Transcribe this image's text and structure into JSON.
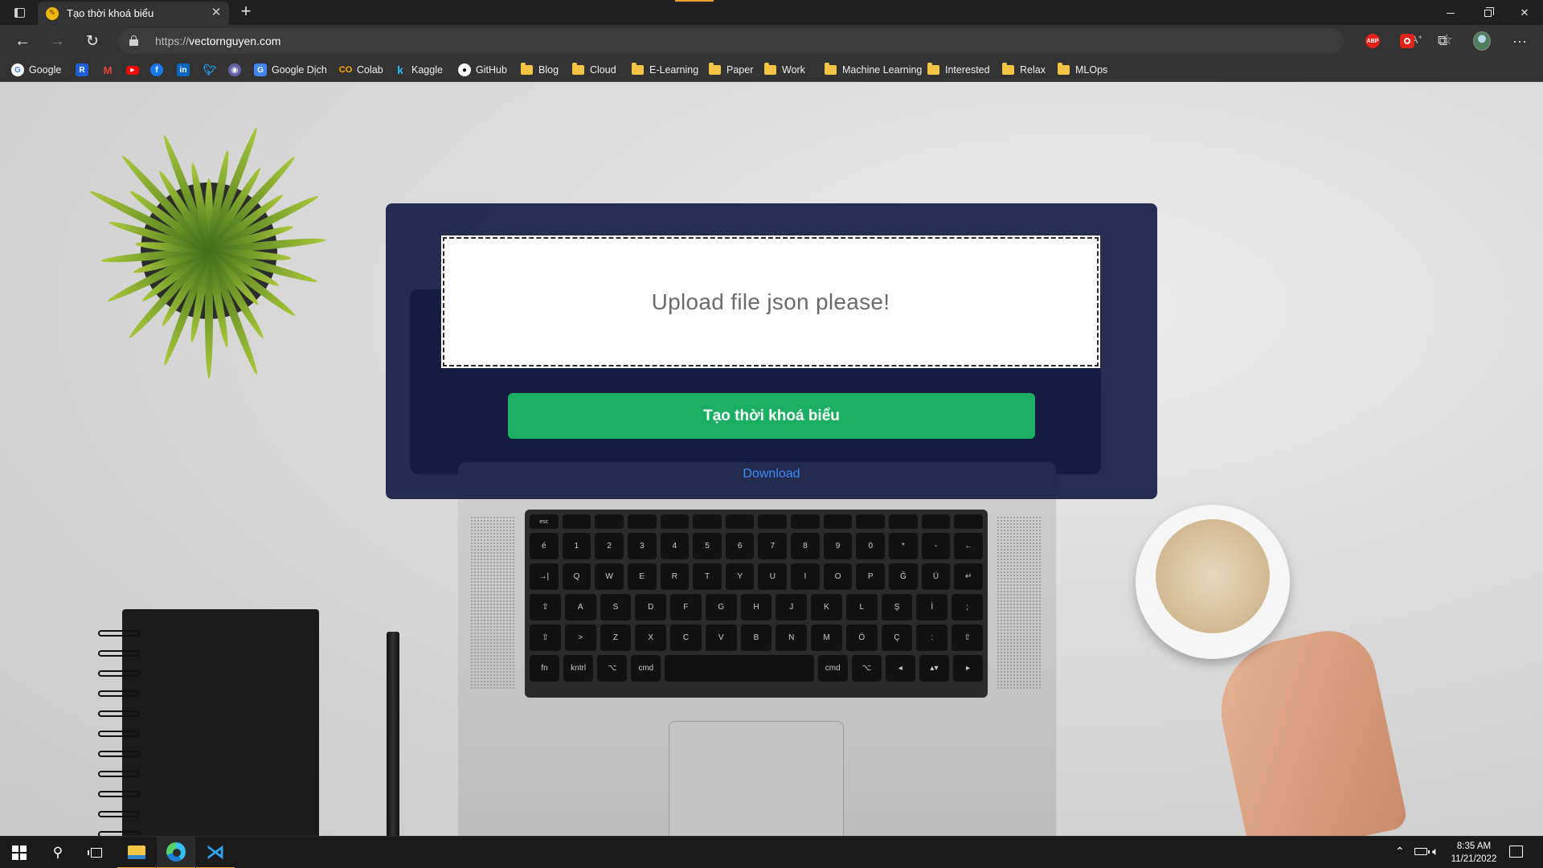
{
  "browser": {
    "tab": {
      "title": "Tạo thời khoá biểu"
    },
    "address": {
      "scheme": "https://",
      "host": "vectornguyen.com"
    },
    "bookmarks": [
      {
        "label": "Google",
        "icon": "google-icon"
      },
      {
        "label": "",
        "icon": "r-app-icon"
      },
      {
        "label": "",
        "icon": "gmail-icon"
      },
      {
        "label": "",
        "icon": "youtube-icon"
      },
      {
        "label": "",
        "icon": "facebook-icon"
      },
      {
        "label": "",
        "icon": "linkedin-icon"
      },
      {
        "label": "",
        "icon": "twitter-icon"
      },
      {
        "label": "",
        "icon": "messenger-icon"
      },
      {
        "label": "Google Dịch",
        "icon": "google-translate-icon"
      },
      {
        "label": "Colab",
        "icon": "colab-icon"
      },
      {
        "label": "Kaggle",
        "icon": "kaggle-icon"
      },
      {
        "label": "GitHub",
        "icon": "github-icon"
      },
      {
        "label": "Blog",
        "icon": "folder-icon"
      },
      {
        "label": "Cloud",
        "icon": "folder-icon"
      },
      {
        "label": "E-Learning",
        "icon": "folder-icon"
      },
      {
        "label": "Paper",
        "icon": "folder-icon"
      },
      {
        "label": "Work",
        "icon": "folder-icon"
      },
      {
        "label": "Machine Learning",
        "icon": "folder-icon"
      },
      {
        "label": "Interested",
        "icon": "folder-icon"
      },
      {
        "label": "Relax",
        "icon": "folder-icon"
      },
      {
        "label": "MLOps",
        "icon": "folder-icon"
      }
    ],
    "extensions": {
      "abp_label": "ABP"
    }
  },
  "page": {
    "dropzone_text": "Upload file json please!",
    "create_button": "Tạo thời khoá biểu",
    "download_link": "Download",
    "colors": {
      "panel": "#151d44",
      "button": "#1aaf62",
      "link": "#3b8bff"
    }
  },
  "keyboard": {
    "rows": [
      [
        "esc",
        "",
        "",
        "",
        "",
        "",
        "",
        "",
        "",
        "",
        "",
        "",
        "",
        ""
      ],
      [
        "é",
        "1",
        "2",
        "3",
        "4",
        "5",
        "6",
        "7",
        "8",
        "9",
        "0",
        "*",
        "-",
        "←"
      ],
      [
        "→|",
        "Q",
        "W",
        "E",
        "R",
        "T",
        "Y",
        "U",
        "I",
        "O",
        "P",
        "Ğ",
        "Ü",
        "↵"
      ],
      [
        "⇪",
        "A",
        "S",
        "D",
        "F",
        "G",
        "H",
        "J",
        "K",
        "L",
        "Ş",
        "İ",
        ";"
      ],
      [
        "⇧",
        ">",
        "Z",
        "X",
        "C",
        "V",
        "B",
        "N",
        "M",
        "Ö",
        "Ç",
        ":",
        "⇧"
      ],
      [
        "fn",
        "kntrl",
        "⌥",
        "cmd",
        "",
        "cmd",
        "⌥",
        "◂",
        "▴▾",
        "▸"
      ]
    ]
  },
  "taskbar": {
    "time": "8:35 AM",
    "date": "11/21/2022"
  }
}
